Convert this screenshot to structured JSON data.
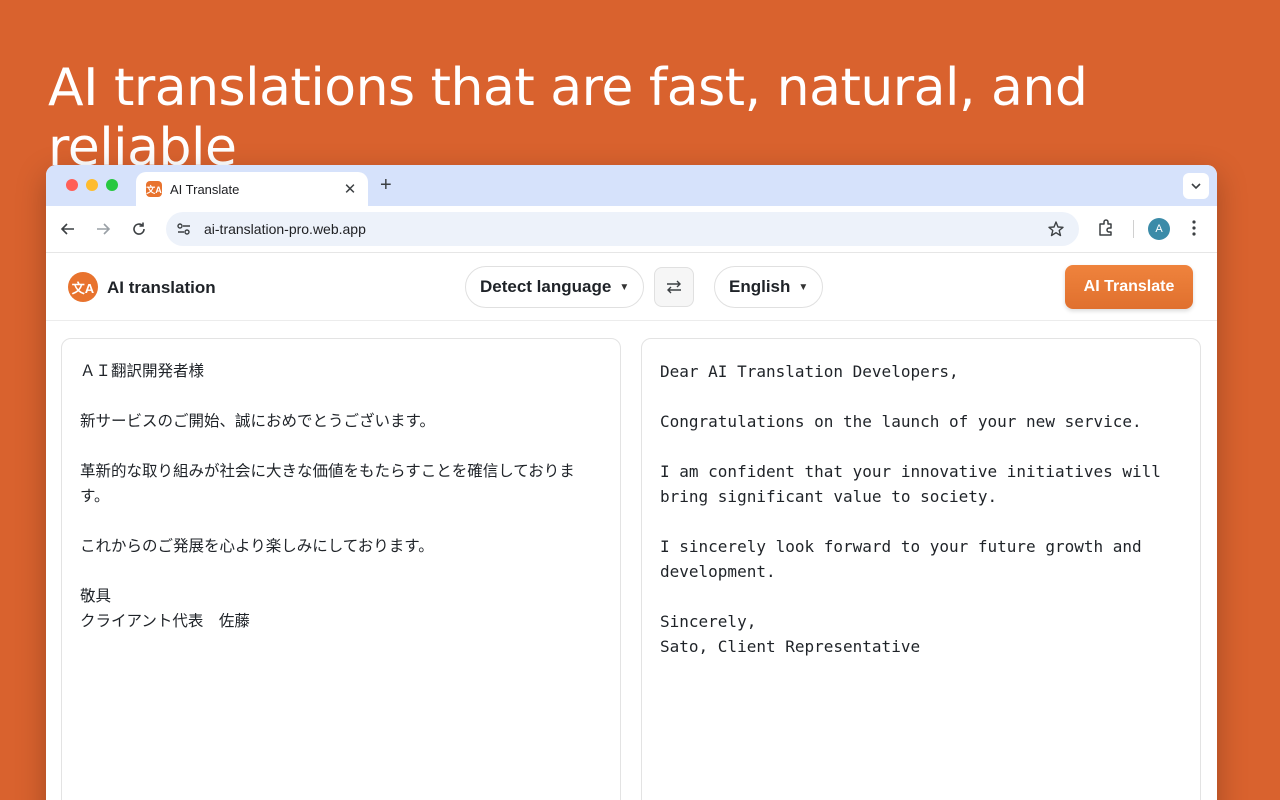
{
  "hero": {
    "headline": "AI translations that are fast, natural, and reliable"
  },
  "browser": {
    "tab": {
      "title": "AI Translate",
      "favicon_text": "文A"
    },
    "url": "ai-translation-pro.web.app",
    "avatar_letter": "A"
  },
  "app": {
    "name": "AI translation",
    "logo_text": "文A",
    "source_language": "Detect language",
    "target_language": "English",
    "translate_label": "AI Translate"
  },
  "source_text": [
    "ＡＩ翻訳開発者様",
    "",
    "新サービスのご開始、誠におめでとうございます。",
    "",
    "革新的な取り組みが社会に大きな価値をもたらすことを確信しておりま",
    "す。",
    "",
    "これからのご発展を心より楽しみにしております。",
    "",
    "敬具",
    "クライアント代表　佐藤"
  ],
  "translated_text": [
    "Dear AI Translation Developers,",
    "",
    "Congratulations on the launch of your new service.",
    "",
    "I am confident that your innovative initiatives will",
    "bring significant value to society.",
    "",
    "I sincerely look forward to your future growth and",
    "development.",
    "",
    "Sincerely,",
    "Sato, Client Representative"
  ],
  "colors": {
    "background": "#D9622E",
    "accent": "#E8732E",
    "tabstrip": "#D6E2FB"
  },
  "icons": [
    "back-arrow-icon",
    "forward-arrow-icon",
    "reload-icon",
    "site-settings-icon",
    "bookmark-star-icon",
    "extensions-icon",
    "more-menu-icon",
    "swap-languages-icon",
    "tab-close-icon",
    "new-tab-icon",
    "tab-search-chevron-icon"
  ]
}
